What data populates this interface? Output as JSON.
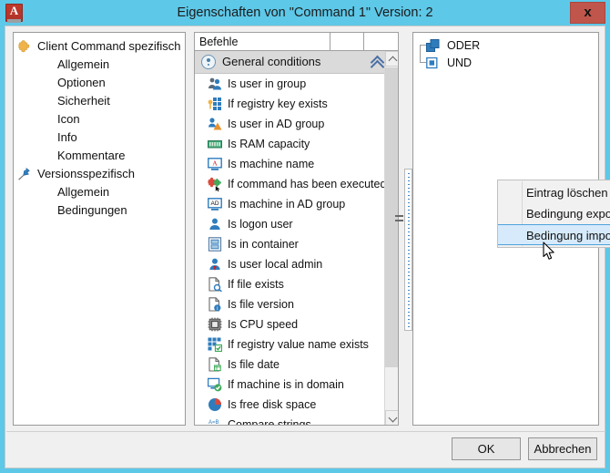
{
  "window": {
    "title": "Eigenschaften von \"Command 1\" Version: 2",
    "app_icon": "letter-a-icon",
    "close_label": "x",
    "titlebar_color": "#5ec8e8",
    "close_button_color": "#c0564b"
  },
  "left_tree": {
    "nodes": [
      {
        "label": "Client Command spezifisch",
        "icon": "puzzle-piece-icon",
        "level": 0
      },
      {
        "label": "Allgemein",
        "icon": "",
        "level": 1
      },
      {
        "label": "Optionen",
        "icon": "",
        "level": 1
      },
      {
        "label": "Sicherheit",
        "icon": "",
        "level": 1
      },
      {
        "label": "Icon",
        "icon": "",
        "level": 1
      },
      {
        "label": "Info",
        "icon": "",
        "level": 1
      },
      {
        "label": "Kommentare",
        "icon": "",
        "level": 1
      },
      {
        "label": "Versionsspezifisch",
        "icon": "pin-icon",
        "level": 0
      },
      {
        "label": "Allgemein",
        "icon": "",
        "level": 1
      },
      {
        "label": "Bedingungen",
        "icon": "",
        "level": 1
      }
    ]
  },
  "command_list": {
    "columns": [
      "Befehle",
      "",
      ""
    ],
    "group": {
      "label": "General conditions",
      "icon": "conditions-icon",
      "collapse_icon": "chevron-double-up-icon"
    },
    "items": [
      {
        "label": "Is user in group",
        "icon": "users-group-icon"
      },
      {
        "label": "If registry key exists",
        "icon": "registry-key-icon"
      },
      {
        "label": "Is user in AD group",
        "icon": "user-ad-group-icon"
      },
      {
        "label": "Is RAM capacity",
        "icon": "ram-icon"
      },
      {
        "label": "Is machine name",
        "icon": "machine-name-icon"
      },
      {
        "label": "If command has been executed",
        "icon": "command-executed-icon"
      },
      {
        "label": "Is machine in AD group",
        "icon": "machine-ad-icon"
      },
      {
        "label": "Is logon user",
        "icon": "user-icon"
      },
      {
        "label": "Is in container",
        "icon": "container-icon"
      },
      {
        "label": "Is user local admin",
        "icon": "user-admin-icon"
      },
      {
        "label": "If file exists",
        "icon": "file-search-icon"
      },
      {
        "label": "Is file version",
        "icon": "file-info-icon"
      },
      {
        "label": "Is CPU speed",
        "icon": "cpu-icon"
      },
      {
        "label": "If registry value name exists",
        "icon": "registry-value-icon"
      },
      {
        "label": "Is file date",
        "icon": "file-date-icon"
      },
      {
        "label": "If machine is in domain",
        "icon": "machine-domain-icon"
      },
      {
        "label": "Is free disk space",
        "icon": "disk-space-icon"
      },
      {
        "label": "Compare strings",
        "icon": "compare-strings-icon"
      }
    ]
  },
  "condition_tree": {
    "nodes": [
      {
        "label": "ODER",
        "icon": "or-block-icon"
      },
      {
        "label": "UND",
        "icon": "and-block-icon"
      }
    ]
  },
  "context_menu": {
    "items": [
      {
        "label": "Eintrag löschen",
        "selected": false
      },
      {
        "label": "Bedingung exportieren",
        "selected": false
      },
      {
        "label": "Bedingung importieren",
        "selected": true
      }
    ],
    "highlight_color": "#d6eafb",
    "highlight_border_color": "#4ea3dc"
  },
  "footer": {
    "ok_label": "OK",
    "cancel_label": "Abbrechen"
  }
}
